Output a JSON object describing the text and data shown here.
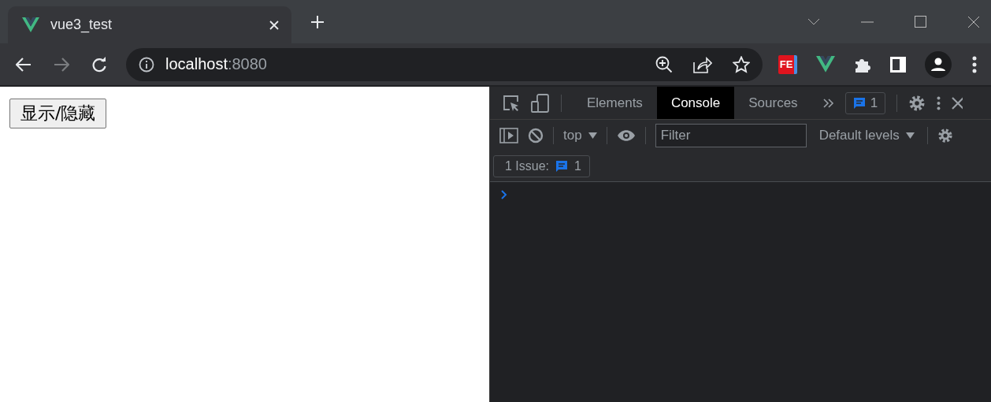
{
  "browser": {
    "tabs": [
      {
        "title": "vue3_test",
        "selected": true
      }
    ],
    "address": {
      "host": "localhost",
      "port": ":8080"
    },
    "extension_badge": "FE"
  },
  "page": {
    "button": "显示/隐藏"
  },
  "devtools": {
    "tabs": [
      {
        "label": "Elements",
        "selected": false
      },
      {
        "label": "Console",
        "selected": true
      },
      {
        "label": "Sources",
        "selected": false
      }
    ],
    "messages_badge": "1",
    "context": "top",
    "filter": {
      "placeholder": "Filter"
    },
    "levels": "Default levels",
    "issues_bar": {
      "label": "1 Issue:",
      "count": "1"
    }
  }
}
